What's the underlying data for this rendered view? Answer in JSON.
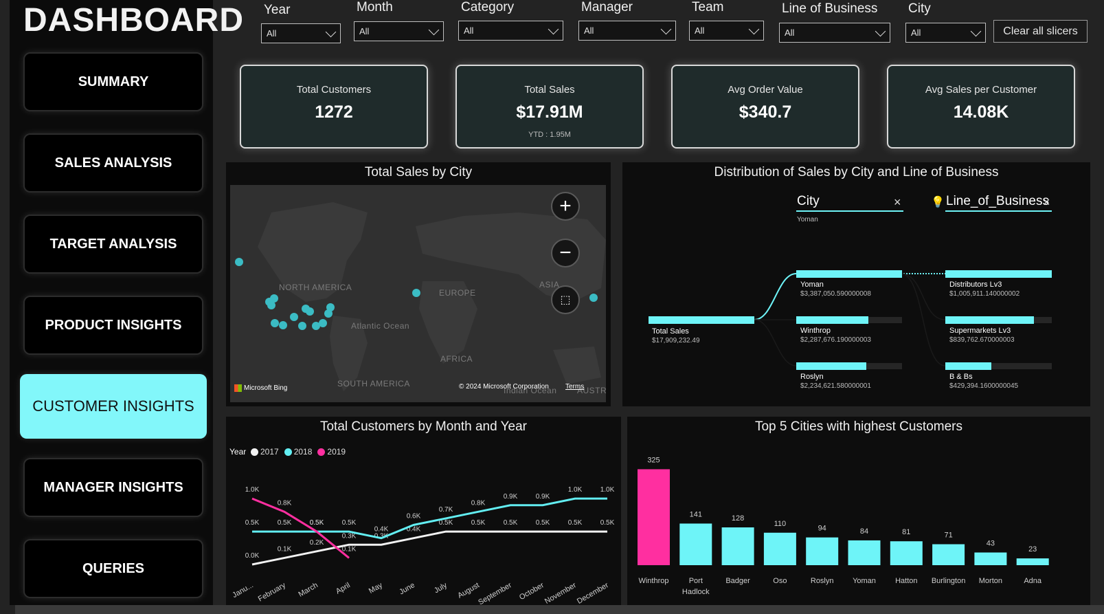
{
  "dashboard_title": "DASHBOARD",
  "nav": [
    {
      "label": "SUMMARY",
      "active": false
    },
    {
      "label": "SALES ANALYSIS",
      "active": false
    },
    {
      "label": "TARGET ANALYSIS",
      "active": false
    },
    {
      "label": "PRODUCT INSIGHTS",
      "active": false
    },
    {
      "label": "CUSTOMER INSIGHTS",
      "active": true
    },
    {
      "label": "MANAGER INSIGHTS",
      "active": false
    },
    {
      "label": "QUERIES",
      "active": false
    }
  ],
  "slicers": [
    {
      "label": "Year",
      "value": "All"
    },
    {
      "label": "Month",
      "value": "All"
    },
    {
      "label": "Category",
      "value": "All"
    },
    {
      "label": "Manager",
      "value": "All"
    },
    {
      "label": "Team",
      "value": "All"
    },
    {
      "label": "Line of Business",
      "value": "All"
    },
    {
      "label": "City",
      "value": "All"
    }
  ],
  "clear_button": "Clear all slicers",
  "kpis": [
    {
      "label": "Total Customers",
      "value": "1272",
      "sub": ""
    },
    {
      "label": "Total Sales",
      "value": "$17.91M",
      "sub": "YTD : 1.95M"
    },
    {
      "label": "Avg Order Value",
      "value": "$340.7",
      "sub": ""
    },
    {
      "label": "Avg Sales per Customer",
      "value": "14.08K",
      "sub": ""
    }
  ],
  "map_panel": {
    "title": "Total Sales by City",
    "labels": {
      "north_america": "NORTH AMERICA",
      "europe": "EUROPE",
      "asia": "ASIA",
      "atlantic": "Atlantic Ocean",
      "africa": "AFRICA",
      "south_america": "SOUTH AMERICA",
      "austr": "AUSTR",
      "indian": "Indian Ocean"
    },
    "attribution": "Microsoft Bing",
    "copyright": "© 2024 Microsoft Corporation",
    "terms": "Terms",
    "accent": "#3bbcc4"
  },
  "decomp_panel": {
    "title": "Distribution of Sales by City and Line of Business",
    "level1_header": "City",
    "level1_selected": "Yoman",
    "level2_header": "Line_of_Business",
    "root": {
      "name": "Total Sales",
      "value": "$17,909,232.49"
    },
    "cities": [
      {
        "name": "Yoman",
        "value": "$3,387,050.590000008",
        "fraction": 1.0
      },
      {
        "name": "Winthrop",
        "value": "$2,287,676.190000003",
        "fraction": 0.68
      },
      {
        "name": "Roslyn",
        "value": "$2,234,621.580000001",
        "fraction": 0.66
      }
    ],
    "lobs": [
      {
        "name": "Distributors Lv3",
        "value": "$1,005,911.140000002",
        "fraction": 1.0
      },
      {
        "name": "Supermarkets Lv3",
        "value": "$839,762.670000003",
        "fraction": 0.83
      },
      {
        "name": "B & Bs",
        "value": "$429,394.1600000045",
        "fraction": 0.43
      }
    ]
  },
  "line_panel": {
    "title": "Total Customers by Month and Year",
    "legend_title": "Year"
  },
  "bar_panel": {
    "title": "Top 5 Cities with highest Customers"
  },
  "chart_data": [
    {
      "type": "line",
      "title": "Total Customers by Month and Year",
      "categories": [
        "January",
        "February",
        "March",
        "April",
        "May",
        "June",
        "July",
        "August",
        "September",
        "October",
        "November",
        "December"
      ],
      "category_display": [
        "Janu...",
        "February",
        "March",
        "April",
        "May",
        "June",
        "July",
        "August",
        "September",
        "October",
        "November",
        "December"
      ],
      "series": [
        {
          "name": "2017",
          "color": "#f2f2f2",
          "values": [
            0.0,
            0.1,
            0.2,
            0.3,
            0.3,
            0.4,
            0.5,
            0.5,
            0.5,
            0.5,
            0.5,
            0.5
          ],
          "labels": [
            "0.0K",
            "0.1K",
            "0.2K",
            "0.3K",
            "0.3K",
            "0.4K",
            "0.5K",
            "0.5K",
            "0.5K",
            "0.5K",
            "0.5K",
            "0.5K"
          ]
        },
        {
          "name": "2018",
          "color": "#62eef2",
          "values": [
            0.5,
            0.5,
            0.5,
            0.5,
            0.4,
            0.6,
            0.7,
            0.8,
            0.9,
            0.9,
            1.0,
            1.0
          ],
          "labels": [
            "0.5K",
            "0.5K",
            "0.5K",
            "0.5K",
            "0.4K",
            "0.6K",
            "0.7K",
            "0.8K",
            "0.9K",
            "0.9K",
            "1.0K",
            "1.0K"
          ]
        },
        {
          "name": "2019",
          "color": "#ff2fa0",
          "values": [
            1.0,
            0.8,
            0.5,
            0.1
          ],
          "labels": [
            "1.0K",
            "0.8K",
            "0.5K",
            "0.1K"
          ]
        }
      ],
      "ylim": [
        0,
        1.2
      ]
    },
    {
      "type": "bar",
      "title": "Top 5 Cities with highest Customers",
      "categories": [
        "Winthrop",
        "Port Hadlock",
        "Badger",
        "Oso",
        "Roslyn",
        "Yoman",
        "Hatton",
        "Burlington",
        "Morton",
        "Adna"
      ],
      "values": [
        325,
        141,
        128,
        110,
        94,
        84,
        81,
        71,
        43,
        23
      ],
      "highlight_color": "#ff2fa0",
      "bar_color": "#6ef4f8",
      "ylim": [
        0,
        340
      ]
    }
  ]
}
